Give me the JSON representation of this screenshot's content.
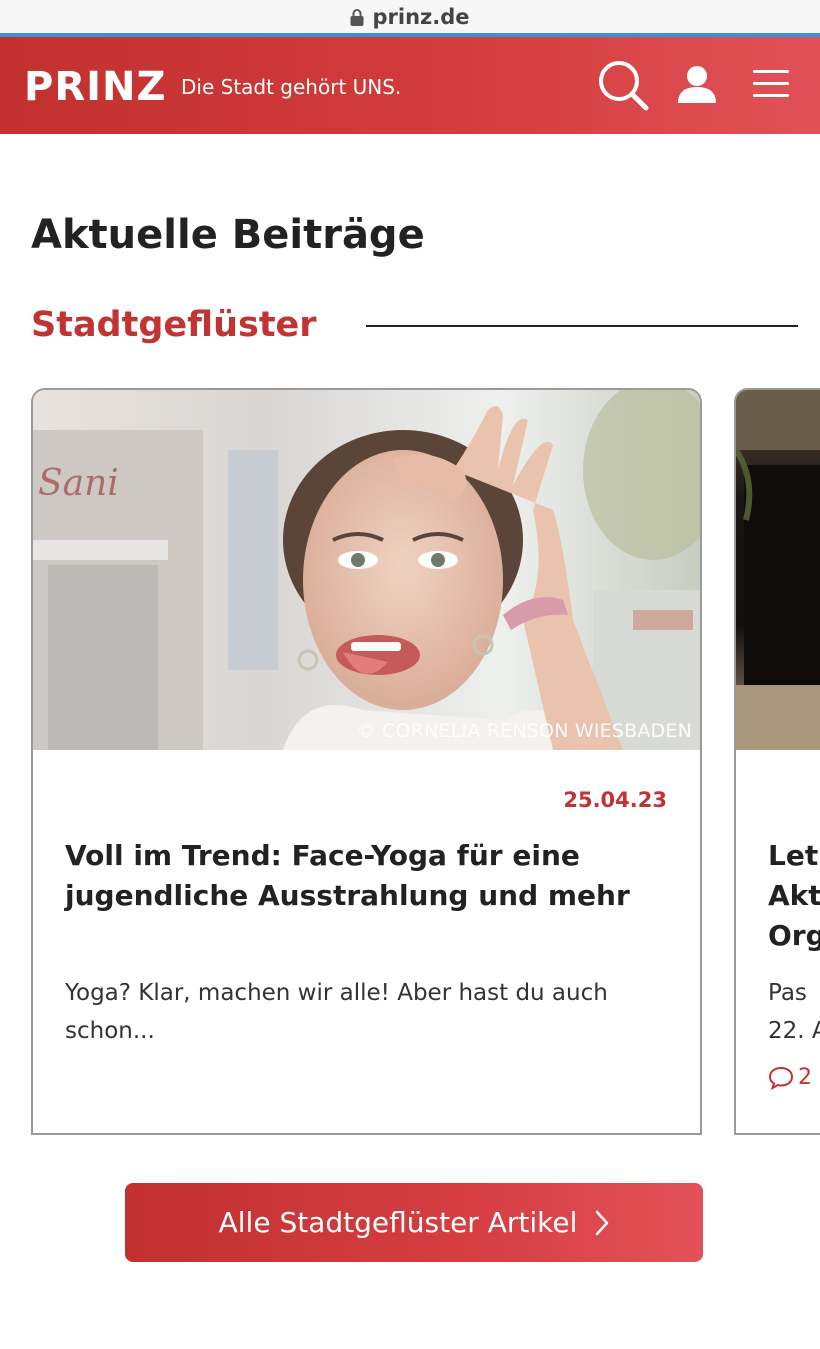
{
  "browser": {
    "url": "prinz.de"
  },
  "header": {
    "logo": "PRINZ",
    "tagline": "Die Stadt gehört UNS.",
    "colors": {
      "brand_red": "#c23030",
      "brand_red_light": "#e05258"
    }
  },
  "main": {
    "section_title": "Aktuelle Beiträge",
    "category": {
      "title": "Stadtgeflüster"
    },
    "cards": [
      {
        "image_credit": "© CORNELIA RENSON WIESBADEN",
        "date": "25.04.23",
        "title": "Voll im Trend: Face-Yoga für eine jugendliche Ausstrahlung und mehr",
        "excerpt": "Yoga? Klar, machen wir alle! Aber hast du auch schon..."
      },
      {
        "title_partial": "Let\nAkt\nOrg",
        "excerpt_partial": "Pas\n22. A",
        "comments_partial": "2"
      }
    ],
    "cta_label": "Alle Stadtgeflüster Artikel"
  }
}
